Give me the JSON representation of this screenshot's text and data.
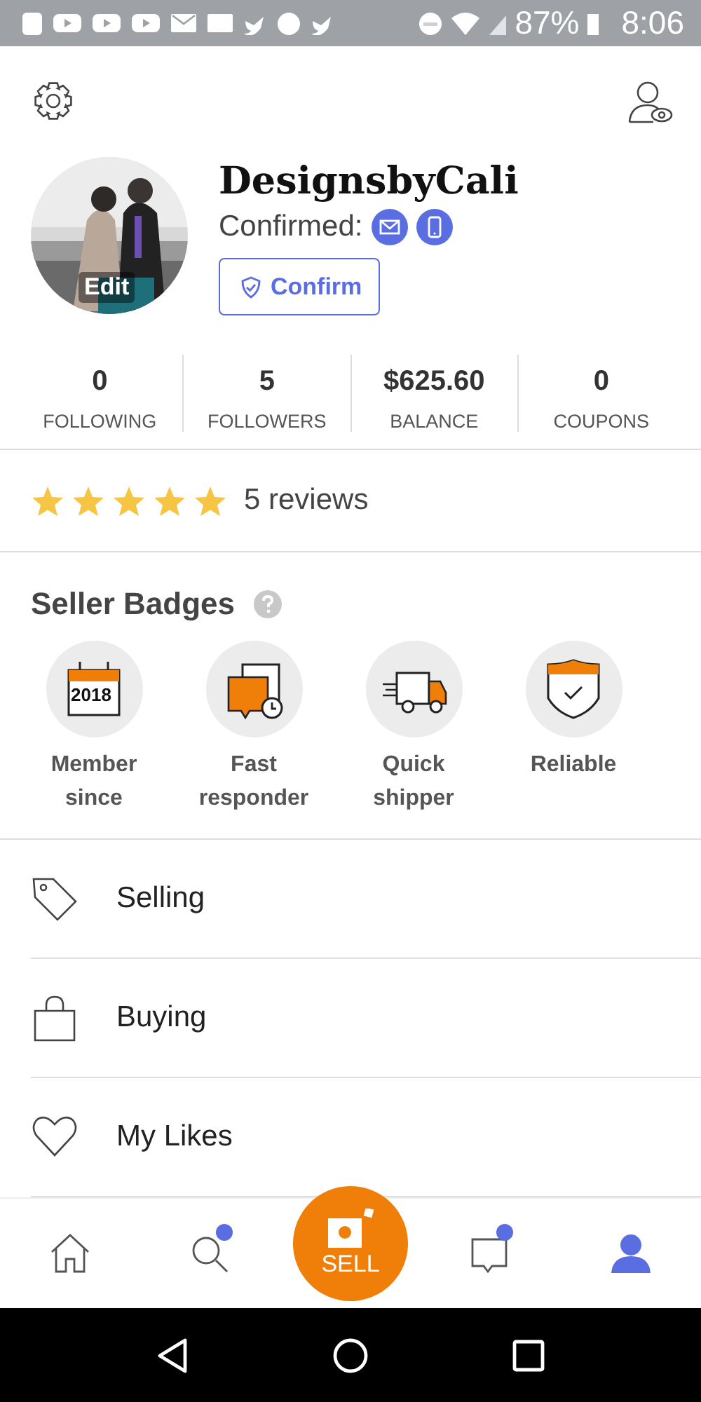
{
  "status_bar": {
    "battery": "87%",
    "time": "8:06"
  },
  "profile": {
    "username": "DesignsbyCali",
    "avatar": {
      "kind": "picture",
      "overlay_label": "Edit"
    },
    "confirmed_label": "Confirmed:",
    "confirm_button": "Confirm"
  },
  "stats": [
    {
      "value": "0",
      "label": "FOLLOWING"
    },
    {
      "value": "5",
      "label": "FOLLOWERS"
    },
    {
      "value": "$625.60",
      "label": "BALANCE"
    },
    {
      "value": "0",
      "label": "COUPONS"
    }
  ],
  "reviews": {
    "stars": 5,
    "label": "5 reviews"
  },
  "seller_badges": {
    "title": "Seller Badges",
    "items": [
      {
        "kind": "calendar",
        "year": "2018",
        "label": "Member since"
      },
      {
        "kind": "chat",
        "label": "Fast responder"
      },
      {
        "kind": "truck",
        "label": "Quick shipper"
      },
      {
        "kind": "shield",
        "label": "Reliable"
      }
    ]
  },
  "menu": [
    {
      "kind": "tag",
      "label": "Selling"
    },
    {
      "kind": "bag",
      "label": "Buying"
    },
    {
      "kind": "heart",
      "label": "My Likes"
    }
  ],
  "bottom_nav": [
    {
      "kind": "home",
      "selected": false,
      "dot": false
    },
    {
      "kind": "search",
      "selected": false,
      "dot": true
    },
    {
      "kind": "sell",
      "label": "SELL",
      "selected": false,
      "dot": false
    },
    {
      "kind": "inbox",
      "selected": false,
      "dot": true
    },
    {
      "kind": "profile",
      "selected": true,
      "dot": false
    }
  ]
}
